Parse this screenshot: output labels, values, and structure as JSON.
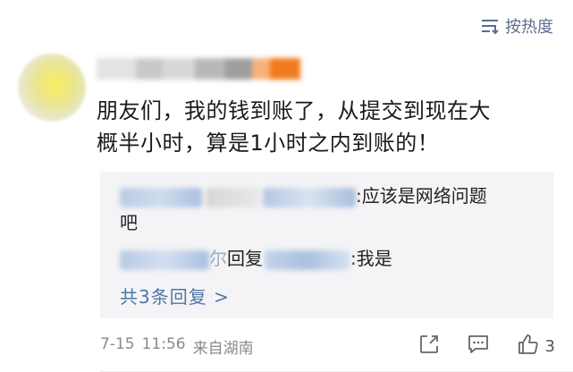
{
  "sort": {
    "label": "按热度",
    "icon": "sort-lines-icon"
  },
  "comment": {
    "line1": "朋友们，我的钱到账了，从提交到现在大",
    "line2": "概半小时，算是1小时之内到账的！",
    "date": "7-15",
    "time": "11:56",
    "location": "来自湖南",
    "likes": "3"
  },
  "replies": [
    {
      "text_tail": ":应该是网络问题",
      "text_wrap": "吧"
    },
    {
      "mid_char": "尔",
      "reply_word": "回复",
      "text_tail": ":我是"
    }
  ],
  "more_replies": "共3条回复 >",
  "colors": {
    "link": "#4f77a8",
    "sort": "#5b6f8f",
    "meta": "#8a8a8a",
    "reply_bg": "#f4f4f6"
  }
}
